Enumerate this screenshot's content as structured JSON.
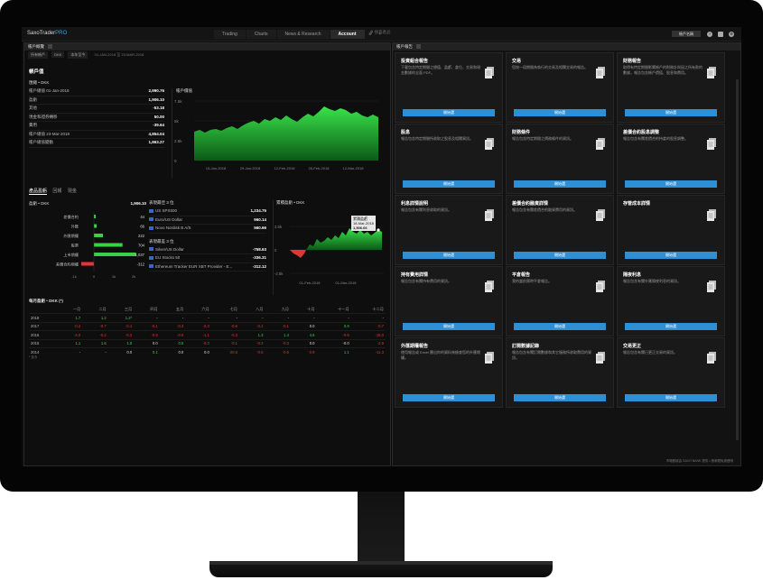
{
  "app": {
    "name": "SaxoTrader",
    "name_suffix": "PRO"
  },
  "nav": {
    "tabs": [
      "Trading",
      "Charts",
      "News & Research",
      "Account"
    ],
    "active": "Account",
    "extra": [
      "≡",
      "+"
    ],
    "search_placeholder": "搜尋產品",
    "user_label": "帳戶名稱"
  },
  "left": {
    "panel_title": "帳戶概覽",
    "filters": [
      "所有帳戶",
      "DKK",
      "本年至今",
      "01-JAN-2018 至 23-MAR-2018"
    ],
    "account_value": {
      "title": "帳戶值",
      "currency_label": "匯總 • DKK",
      "rows": [
        {
          "label": "帳戶總值 01-Jan-2018",
          "value": "2,990.76"
        },
        {
          "label": "盈虧",
          "value": "1,906.10"
        },
        {
          "label": "其他",
          "value": "-53.18"
        },
        {
          "label": "現金和證券轉移",
          "value": "50.00"
        },
        {
          "label": "費用",
          "value": "-39.64"
        },
        {
          "label": "帳戶總值 23-Mar-2018",
          "value": "4,854.04"
        },
        {
          "label": "帳戶總值變動",
          "value": "1,863.27"
        }
      ]
    },
    "value_chart": {
      "title": "帳戶價值",
      "y_ticks": [
        "7.5k",
        "5k",
        "2.5k",
        "0"
      ],
      "x_ticks": [
        "15-Jan-2018",
        "29-Jan-2018",
        "12-Feb-2018",
        "26-Feb-2018",
        "12-Mar-2018"
      ]
    },
    "tabs": [
      "產品盈虧",
      "回報",
      "現金"
    ],
    "pnl": {
      "currency_label": "盈虧 • DKK",
      "total": "1,906.10",
      "rows": [
        {
          "label": "差價合約",
          "value": "44"
        },
        {
          "label": "外匯",
          "value": "66"
        },
        {
          "label": "外匯期權",
          "value": "222"
        },
        {
          "label": "股票",
          "value": "704"
        },
        {
          "label": "上市期權",
          "value": "1,037"
        },
        {
          "label": "差價合約期權",
          "value": "-312"
        }
      ],
      "axis": [
        "-1k",
        "0",
        "1k",
        "2k"
      ]
    },
    "best": {
      "title": "表現最佳 3 位",
      "rows": [
        {
          "name": "US SPX500",
          "value": "1,234.75"
        },
        {
          "name": "Euro/US Dollar",
          "value": "960.14"
        },
        {
          "name": "Novo Nordisk B A/S",
          "value": "560.66"
        }
      ]
    },
    "worst": {
      "title": "表現最差 3 位",
      "rows": [
        {
          "name": "Silver/US Dollar",
          "value": "-758.63"
        },
        {
          "name": "EU Stocks 50",
          "value": "-336.31"
        },
        {
          "name": "Ethereum Tracker EUR XBT Provider - E...",
          "value": "-312.12"
        }
      ]
    },
    "cum_chart": {
      "title": "累積盈虧 • DKK",
      "y_ticks": [
        "2.5k",
        "0",
        "-2.5k"
      ],
      "x_ticks": [
        "01-Feb-2018",
        "01-Mar-2018"
      ],
      "tooltip_title": "累積盈虧",
      "tooltip_date": "18-Mar-2018",
      "tooltip_value": "1,506.66"
    },
    "monthly": {
      "title": "每月盈虧 • DKK (*)",
      "months": [
        "一月",
        "二月",
        "三月",
        "四月",
        "五月",
        "六月",
        "七月",
        "八月",
        "九月",
        "十月",
        "十一月",
        "十二月"
      ],
      "rows": [
        {
          "year": "2018",
          "cells": [
            "1.7",
            "1.2",
            "1.2*",
            "-",
            "-",
            "-",
            "-",
            "-",
            "-",
            "-",
            "-",
            "-"
          ]
        },
        {
          "year": "2017",
          "cells": [
            "-0.2",
            "-0.7",
            "-0.1",
            "-0.1",
            "-0.3",
            "-2.3",
            "-0.6",
            "-0.2",
            "-0.1",
            "0.0",
            "0.9",
            "-0.7"
          ]
        },
        {
          "year": "2016",
          "cells": [
            "-4.0",
            "-0.2",
            "-0.2",
            "-0.9",
            "-0.9",
            "-1.1",
            "-0.3",
            "1.3",
            "1.4",
            "4.6",
            "-0.8",
            "-18.0"
          ]
        },
        {
          "year": "2015",
          "cells": [
            "1.1",
            "1.6",
            "1.5",
            "0.0",
            "0.5",
            "-0.3",
            "-0.1",
            "-0.3",
            "-0.3",
            "0.0",
            "-0.0",
            "-2.8"
          ]
        },
        {
          "year": "2014",
          "cells": [
            "-",
            "-",
            "0.0",
            "0.1",
            "0.0",
            "0.0",
            "-20.5",
            "-0.5",
            "-0.5",
            "-0.9",
            "1.1",
            "-11.3"
          ]
        }
      ],
      "note": "* 至今"
    }
  },
  "right": {
    "panel_title": "帳戶報告",
    "button_label": "開始選",
    "cards": [
      {
        "title": "投資組合報告",
        "desc": "下載包含特定期間之總值、盈虧、倉位、交易和現金數據的全面 PDF。"
      },
      {
        "title": "交易",
        "desc": "您按一段期間為執行的交易及相關交易的報告。"
      },
      {
        "title": "財務報告",
        "desc": "取得有特定期間影響帳戶的財務計與因之所有款的數據，報告包含帳戶價值、股息和費用。"
      },
      {
        "title": "股息",
        "desc": "報告包含特定期間所收取之股息及相關資訊。"
      },
      {
        "title": "財務條件",
        "desc": "報告包含特定期間之債務條件的資訊。"
      },
      {
        "title": "差價合約股息調整",
        "desc": "報告包含有關差價合約持倉的股息調整。"
      },
      {
        "title": "利息詳情說明",
        "desc": "報告包含有關利息收取的資訊。"
      },
      {
        "title": "差價合約融資詳情",
        "desc": "報告包含有關差價合約融資費用的資訊。"
      },
      {
        "title": "存管成本詳情",
        "desc": ""
      },
      {
        "title": "持有費用詳情",
        "desc": "報告包含有關持有費用的資訊。"
      },
      {
        "title": "平倉報告",
        "desc": "我的當前實時平倉報告。"
      },
      {
        "title": "隔夜利息",
        "desc": "報告包含有關外匯隔夜利息的資訊。"
      },
      {
        "title": "外匯期權報告",
        "desc": "使用報告或 Excel 匯出你的資料來檢查您的外匯期權。"
      },
      {
        "title": "訂閱數據記錄",
        "desc": "報告包含有關訂閱數據和其它服務所收取費用的資訊。"
      },
      {
        "title": "交易更正",
        "desc": "報告包含有關已更正交易的資訊。"
      }
    ],
    "footer": "市場數據由 SAXO BANK 提供 • 請參閱免責聲明"
  },
  "colors": {
    "accent": "#2d8fd5",
    "positive": "#3cd04a",
    "negative": "#e23535"
  }
}
